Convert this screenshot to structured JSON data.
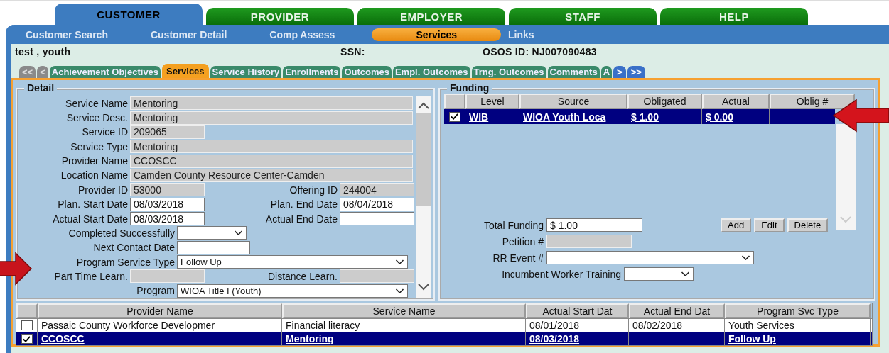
{
  "main_tabs": [
    {
      "label": "CUSTOMER",
      "selected": true
    },
    {
      "label": "PROVIDER",
      "selected": false
    },
    {
      "label": "EMPLOYER",
      "selected": false
    },
    {
      "label": "STAFF",
      "selected": false
    },
    {
      "label": "HELP",
      "selected": false
    }
  ],
  "sub_nav": [
    {
      "label": "Customer Search",
      "selected": false
    },
    {
      "label": "Customer Detail",
      "selected": false
    },
    {
      "label": "Comp Assess",
      "selected": false
    },
    {
      "label": "Services",
      "selected": true
    },
    {
      "label": "Links",
      "selected": false
    }
  ],
  "customer": {
    "name": "test , youth",
    "ssn_label": "SSN:",
    "osos_id": "OSOS ID: NJ007090483"
  },
  "section_tabs": {
    "first": "<<",
    "prev": "<",
    "next": ">",
    "last": ">>",
    "items": [
      {
        "label": "Achievement Objectives",
        "selected": false
      },
      {
        "label": "Services",
        "selected": true
      },
      {
        "label": "Service History",
        "selected": false
      },
      {
        "label": "Enrollments",
        "selected": false
      },
      {
        "label": "Outcomes",
        "selected": false
      },
      {
        "label": "Empl. Outcomes",
        "selected": false
      },
      {
        "label": "Trng. Outcomes",
        "selected": false
      },
      {
        "label": "Comments",
        "selected": false
      },
      {
        "label": "A",
        "selected": false
      }
    ]
  },
  "detail": {
    "title": "Detail",
    "rows": [
      {
        "kind": "wide",
        "fields": [
          {
            "label": "Service Name",
            "value": "Mentoring",
            "disabled": true
          }
        ]
      },
      {
        "kind": "wide",
        "fields": [
          {
            "label": "Service Desc.",
            "value": "Mentoring",
            "disabled": true
          }
        ]
      },
      {
        "kind": "short",
        "fields": [
          {
            "label": "Service ID",
            "value": "209065",
            "disabled": true
          }
        ]
      },
      {
        "kind": "wide",
        "fields": [
          {
            "label": "Service Type",
            "value": "Mentoring",
            "disabled": true
          }
        ]
      },
      {
        "kind": "wide",
        "fields": [
          {
            "label": "Provider Name",
            "value": "CCOSCC",
            "disabled": true
          }
        ]
      },
      {
        "kind": "wide",
        "fields": [
          {
            "label": "Location Name",
            "value": "Camden County Resource Center-Camden",
            "disabled": true
          }
        ]
      },
      {
        "kind": "pair",
        "fields": [
          {
            "label": "Provider ID",
            "value": "53000",
            "disabled": true
          },
          {
            "label": "Offering ID",
            "value": "244004",
            "disabled": true
          }
        ]
      },
      {
        "kind": "pair",
        "fields": [
          {
            "label": "Plan. Start Date",
            "value": "08/03/2018",
            "disabled": false
          },
          {
            "label": "Plan. End Date",
            "value": "08/04/2018",
            "disabled": false
          }
        ]
      },
      {
        "kind": "pair",
        "fields": [
          {
            "label": "Actual Start Date",
            "value": "08/03/2018",
            "disabled": false
          },
          {
            "label": "Actual End Date",
            "disabled": false
          }
        ]
      },
      {
        "kind": "select-short",
        "fields": [
          {
            "label": "Completed Successfully",
            "disabled": false
          }
        ]
      },
      {
        "kind": "input-short",
        "fields": [
          {
            "label": "Next Contact Date",
            "disabled": false
          }
        ]
      },
      {
        "kind": "select-wide",
        "fields": [
          {
            "label": "Program Service Type",
            "value": "Follow Up",
            "disabled": false
          }
        ]
      },
      {
        "kind": "pair",
        "fields": [
          {
            "label": "Part Time Learn.",
            "disabled": true
          },
          {
            "label": "Distance Learn.",
            "disabled": true
          }
        ]
      },
      {
        "kind": "select-wide",
        "fields": [
          {
            "label": "Program",
            "value": "WIOA Title I (Youth)",
            "disabled": false
          }
        ]
      }
    ]
  },
  "funding": {
    "title": "Funding",
    "columns": [
      "Level",
      "Source",
      "Obligated",
      "Actual",
      "Oblig #"
    ],
    "rows": [
      {
        "checked": true,
        "selected": true,
        "cells": [
          "WIB",
          "WIOA Youth Loca",
          "$ 1.00",
          "$ 0.00"
        ]
      }
    ],
    "total_label": "Total Funding",
    "total_value": "$ 1.00",
    "buttons": [
      "Add",
      "Edit",
      "Delete"
    ],
    "petition_label": "Petition #",
    "rr_event_label": "RR Event #",
    "incumbent_label": "Incumbent Worker Training"
  },
  "services_table": {
    "columns": [
      "Provider Name",
      "Service Name",
      "Actual Start Dat",
      "Actual End Dat",
      "Program Svc Type"
    ],
    "rows": [
      {
        "checked": false,
        "selected": false,
        "cells": [
          "Passaic County Workforce Developmer",
          "Financial literacy",
          "08/01/2018",
          "08/02/2018",
          "Youth Services"
        ]
      },
      {
        "checked": true,
        "selected": true,
        "cells": [
          "CCOSCC",
          "Mentoring",
          "08/03/2018",
          null,
          "Follow Up"
        ]
      }
    ]
  }
}
